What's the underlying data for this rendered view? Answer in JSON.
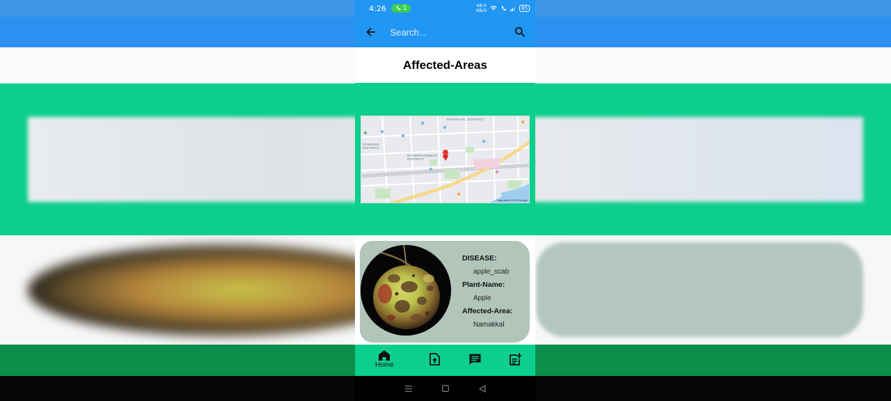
{
  "status_bar": {
    "time": "4:26",
    "pill_count": "1",
    "speed_top": "48.0",
    "speed_bottom": "KB/S",
    "battery": "85"
  },
  "app_bar": {
    "search_placeholder": "Search..."
  },
  "page": {
    "title": "Affected-Areas"
  },
  "map": {
    "labels": [
      "FINANCIAL DISTRICT",
      "FASHION DISTRICT",
      "ENTERTAINMENT DISTRICT"
    ],
    "credit": "Map data ©2018 Google"
  },
  "card": {
    "disease_label": "DISEASE:",
    "disease_value": "apple_scab",
    "plant_label": "Plant-Name:",
    "plant_value": "Apple",
    "area_label": "Affected-Area:",
    "area_value": "Namakkal"
  },
  "bottom_nav": {
    "home_label": "Home",
    "items": [
      "home-icon",
      "upload-icon",
      "chat-icon",
      "post-add-icon"
    ]
  },
  "colors": {
    "primary_blue": "#2196f3",
    "accent_green": "#0dcf8d",
    "card_bg": "#b1c5bb"
  }
}
